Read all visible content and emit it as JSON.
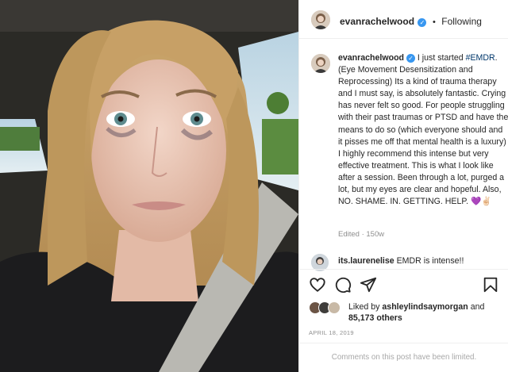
{
  "post": {
    "author": "evanrachelwood",
    "follow_state": "Following",
    "separator": "•"
  },
  "caption": {
    "author": "evanrachelwood",
    "lead": " I just started ",
    "hashtag": "#EMDR",
    "body": ". (Eye Movement Desensitization and Reprocessing) Its a kind of trauma therapy and I must say, is absolutely fantastic. Crying has never felt so good. For people struggling with their past traumas or PTSD and have the means to do so (which everyone should and it pisses me off that mental health is a luxury) I highly recommend this intense but very effective treatment. This is what I look like after a session. Been through a lot, purged a lot, but my eyes are clear and hopeful. Also,",
    "closing": "NO. SHAME. IN. GETTING. HELP.",
    "emoji": "💜✌🏻",
    "meta": "Edited · 150w"
  },
  "comment": {
    "author": "its.laurenelise",
    "text": " EMDR is intense!!"
  },
  "actions": {
    "like_icon": "heart-icon",
    "comment_icon": "comment-icon",
    "share_icon": "share-icon",
    "save_icon": "bookmark-icon"
  },
  "likes": {
    "prefix": "Liked by ",
    "user": "ashleylindsaymorgan",
    "middle": " and ",
    "count": "85,173 others"
  },
  "date": "APRIL 18, 2019",
  "comments_limited": "Comments on this post have been limited.",
  "colors": {
    "verified": "#3897f0",
    "hashtag": "#00376b",
    "heart_emoji": "#8e44ad"
  }
}
